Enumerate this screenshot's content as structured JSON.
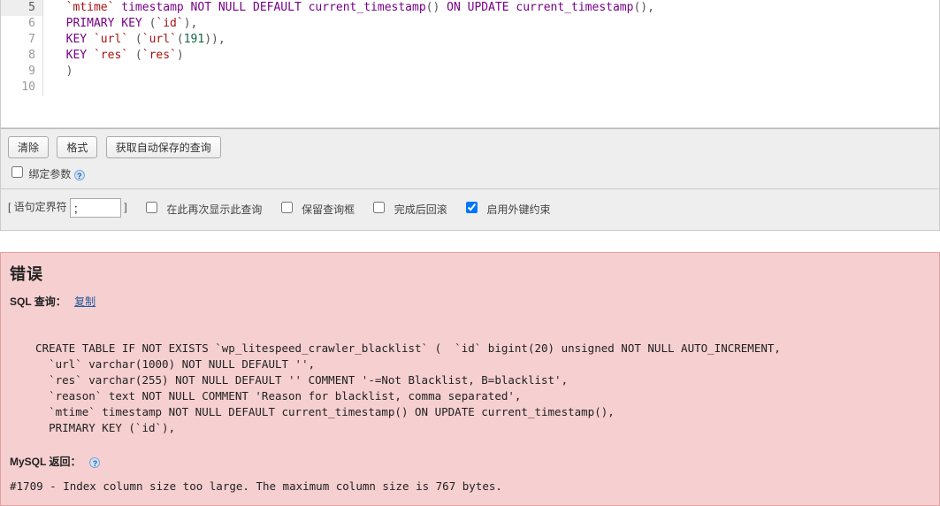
{
  "editor": {
    "gutter": [
      "5",
      "6",
      "7",
      "8",
      "9",
      "10"
    ],
    "line_5_pre": "  `mtime`",
    "line_5_kw": " timestamp NOT NULL DEFAULT current_timestamp",
    "line_5_paren1": "()",
    "line_5_kw2": " ON UPDATE current_timestamp",
    "line_5_paren2": "()",
    "line_5_end": ",",
    "line_6_kw": "  PRIMARY KEY ",
    "line_6_p1": "(",
    "line_6_id": "`id`",
    "line_6_p2": ")",
    "line_6_end": ",",
    "line_7_kw": "  KEY ",
    "line_7_id1": "`url`",
    "line_7_p1": " (",
    "line_7_id2": "`url`",
    "line_7_p2": "(",
    "line_7_num": "191",
    "line_7_p3": "))",
    "line_7_end": ",",
    "line_8_kw": "  KEY ",
    "line_8_id1": "`res`",
    "line_8_p1": " (",
    "line_8_id2": "`res`",
    "line_8_p2": ")",
    "line_9": "  )"
  },
  "toolbar": {
    "clear": "清除",
    "format": "格式",
    "autosaved": "获取自动保存的查询",
    "bind_params": "绑定参数"
  },
  "options": {
    "delimiter_label_open": "[ 语句定界符",
    "delimiter_value": ";",
    "delimiter_label_close": "]",
    "show_again": "在此再次显示此查询",
    "keep_box": "保留查询框",
    "rollback": "完成后回滚",
    "fk_checks": "启用外键约束",
    "fk_checked": true
  },
  "error": {
    "title": "错误",
    "sql_label": "SQL 查询：",
    "copy": "复制",
    "sql": "  CREATE TABLE IF NOT EXISTS `wp_litespeed_crawler_blacklist` (  `id` bigint(20) unsigned NOT NULL AUTO_INCREMENT,\n    `url` varchar(1000) NOT NULL DEFAULT '',\n    `res` varchar(255) NOT NULL DEFAULT '' COMMENT '-=Not Blacklist, B=blacklist',\n    `reason` text NOT NULL COMMENT 'Reason for blacklist, comma separated',\n    `mtime` timestamp NOT NULL DEFAULT current_timestamp() ON UPDATE current_timestamp(),\n    PRIMARY KEY (`id`),",
    "mysql_label": "MySQL 返回：",
    "msg": "#1709 - Index column size too large. The maximum column size is 767 bytes."
  }
}
